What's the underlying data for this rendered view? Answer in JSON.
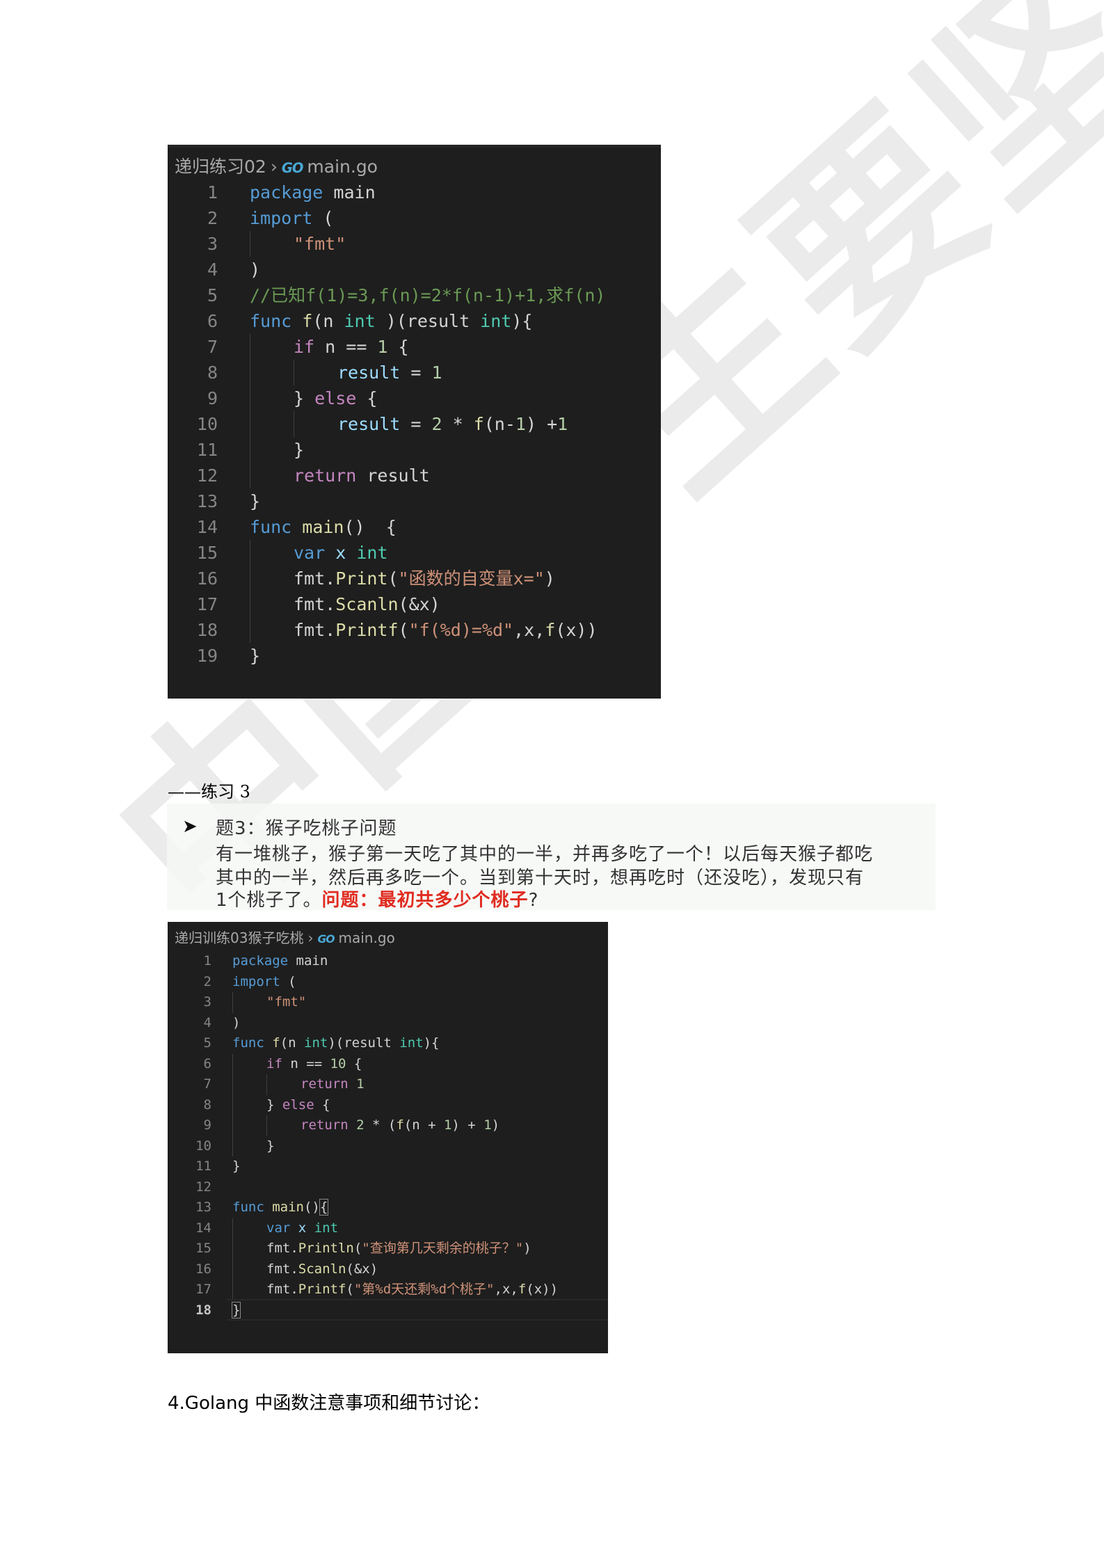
{
  "watermark": "中国学生要坚持",
  "block1": {
    "breadcrumb": {
      "folder": "递归练习02",
      "separator": "›",
      "icon": "go-icon",
      "icon_text": "GO",
      "file": "main.go"
    },
    "lines": [
      {
        "n": "1",
        "indent": 0,
        "tokens": [
          [
            "k-blue",
            "package"
          ],
          [
            "k-def",
            " main"
          ]
        ]
      },
      {
        "n": "2",
        "indent": 0,
        "tokens": [
          [
            "k-blue",
            "import"
          ],
          [
            "k-def",
            " ("
          ]
        ]
      },
      {
        "n": "3",
        "indent": 1,
        "tokens": [
          [
            "k-str",
            "\"fmt\""
          ]
        ]
      },
      {
        "n": "4",
        "indent": 0,
        "tokens": [
          [
            "k-def",
            ")"
          ]
        ]
      },
      {
        "n": "5",
        "indent": 0,
        "tokens": [
          [
            "k-cmt",
            "//已知f(1)=3,f(n)=2*f(n-1)+1,求f(n)"
          ]
        ]
      },
      {
        "n": "6",
        "indent": 0,
        "tokens": [
          [
            "k-blue",
            "func"
          ],
          [
            "k-def",
            " "
          ],
          [
            "k-yellow",
            "f"
          ],
          [
            "k-def",
            "(n "
          ],
          [
            "k-teal",
            "int"
          ],
          [
            "k-def",
            " )(result "
          ],
          [
            "k-teal",
            "int"
          ],
          [
            "k-def",
            "){"
          ]
        ]
      },
      {
        "n": "7",
        "indent": 1,
        "tokens": [
          [
            "k-purple",
            "if"
          ],
          [
            "k-def",
            " n == "
          ],
          [
            "k-num",
            "1"
          ],
          [
            "k-def",
            " {"
          ]
        ]
      },
      {
        "n": "8",
        "indent": 2,
        "tokens": [
          [
            "k-var",
            "result"
          ],
          [
            "k-def",
            " = "
          ],
          [
            "k-num",
            "1"
          ]
        ]
      },
      {
        "n": "9",
        "indent": 1,
        "tokens": [
          [
            "k-def",
            "} "
          ],
          [
            "k-purple",
            "else"
          ],
          [
            "k-def",
            " {"
          ]
        ]
      },
      {
        "n": "10",
        "indent": 2,
        "tokens": [
          [
            "k-var",
            "result"
          ],
          [
            "k-def",
            " = "
          ],
          [
            "k-num",
            "2"
          ],
          [
            "k-def",
            " * "
          ],
          [
            "k-yellow",
            "f"
          ],
          [
            "k-def",
            "(n-"
          ],
          [
            "k-num",
            "1"
          ],
          [
            "k-def",
            ") +"
          ],
          [
            "k-num",
            "1"
          ]
        ]
      },
      {
        "n": "11",
        "indent": 1,
        "tokens": [
          [
            "k-def",
            "}"
          ]
        ]
      },
      {
        "n": "12",
        "indent": 1,
        "tokens": [
          [
            "k-purple",
            "return"
          ],
          [
            "k-def",
            " result"
          ]
        ]
      },
      {
        "n": "13",
        "indent": 0,
        "tokens": [
          [
            "k-def",
            "}"
          ]
        ]
      },
      {
        "n": "14",
        "indent": 0,
        "tokens": [
          [
            "k-blue",
            "func"
          ],
          [
            "k-def",
            " "
          ],
          [
            "k-yellow",
            "main"
          ],
          [
            "k-def",
            "()  {"
          ]
        ]
      },
      {
        "n": "15",
        "indent": 1,
        "tokens": [
          [
            "k-blue",
            "var"
          ],
          [
            "k-def",
            " "
          ],
          [
            "k-var",
            "x"
          ],
          [
            "k-def",
            " "
          ],
          [
            "k-teal",
            "int"
          ]
        ]
      },
      {
        "n": "16",
        "indent": 1,
        "tokens": [
          [
            "k-def",
            "fmt."
          ],
          [
            "k-yellow",
            "Print"
          ],
          [
            "k-def",
            "("
          ],
          [
            "k-str",
            "\"函数的自变量x=\""
          ],
          [
            "k-def",
            ")"
          ]
        ]
      },
      {
        "n": "17",
        "indent": 1,
        "tokens": [
          [
            "k-def",
            "fmt."
          ],
          [
            "k-yellow",
            "Scanln"
          ],
          [
            "k-def",
            "(&x)"
          ]
        ]
      },
      {
        "n": "18",
        "indent": 1,
        "tokens": [
          [
            "k-def",
            "fmt."
          ],
          [
            "k-yellow",
            "Printf"
          ],
          [
            "k-def",
            "("
          ],
          [
            "k-str",
            "\"f(%d)=%d\""
          ],
          [
            "k-def",
            ",x,"
          ],
          [
            "k-yellow",
            "f"
          ],
          [
            "k-def",
            "(x))"
          ]
        ]
      },
      {
        "n": "19",
        "indent": 0,
        "tokens": [
          [
            "k-def",
            "}"
          ]
        ]
      }
    ]
  },
  "section_label": "——练习 3",
  "problem": {
    "bullet": "➤",
    "title": "题3：猴子吃桃子问题",
    "line1": "有一堆桃子，猴子第一天吃了其中的一半，并再多吃了一个！以后每天猴子都吃",
    "line2": "其中的一半，然后再多吃一个。当到第十天时，想再吃时（还没吃），发现只有",
    "line3_prefix": "1个桃子了。",
    "line3_highlight": "问题：最初共多少个桃子",
    "line3_suffix": "?"
  },
  "block2": {
    "breadcrumb": {
      "folder": "递归训练03猴子吃桃",
      "separator": "›",
      "icon": "go-icon",
      "icon_text": "GO",
      "file": "main.go"
    },
    "active_line": "18",
    "lines": [
      {
        "n": "1",
        "indent": 0,
        "tokens": [
          [
            "k-blue",
            "package"
          ],
          [
            "k-def",
            " main"
          ]
        ]
      },
      {
        "n": "2",
        "indent": 0,
        "tokens": [
          [
            "k-blue",
            "import"
          ],
          [
            "k-def",
            " ("
          ]
        ]
      },
      {
        "n": "3",
        "indent": 1,
        "tokens": [
          [
            "k-str",
            "\"fmt\""
          ]
        ]
      },
      {
        "n": "4",
        "indent": 0,
        "tokens": [
          [
            "k-def",
            ")"
          ]
        ]
      },
      {
        "n": "5",
        "indent": 0,
        "tokens": [
          [
            "k-blue",
            "func"
          ],
          [
            "k-def",
            " "
          ],
          [
            "k-yellow",
            "f"
          ],
          [
            "k-def",
            "(n "
          ],
          [
            "k-teal",
            "int"
          ],
          [
            "k-def",
            ")(result "
          ],
          [
            "k-teal",
            "int"
          ],
          [
            "k-def",
            "){"
          ]
        ]
      },
      {
        "n": "6",
        "indent": 1,
        "tokens": [
          [
            "k-purple",
            "if"
          ],
          [
            "k-def",
            " n == "
          ],
          [
            "k-num",
            "10"
          ],
          [
            "k-def",
            " {"
          ]
        ]
      },
      {
        "n": "7",
        "indent": 2,
        "tokens": [
          [
            "k-purple",
            "return"
          ],
          [
            "k-def",
            " "
          ],
          [
            "k-num",
            "1"
          ]
        ]
      },
      {
        "n": "8",
        "indent": 1,
        "tokens": [
          [
            "k-def",
            "} "
          ],
          [
            "k-purple",
            "else"
          ],
          [
            "k-def",
            " {"
          ]
        ]
      },
      {
        "n": "9",
        "indent": 2,
        "tokens": [
          [
            "k-purple",
            "return"
          ],
          [
            "k-def",
            " "
          ],
          [
            "k-num",
            "2"
          ],
          [
            "k-def",
            " * ("
          ],
          [
            "k-yellow",
            "f"
          ],
          [
            "k-def",
            "(n + "
          ],
          [
            "k-num",
            "1"
          ],
          [
            "k-def",
            ") + "
          ],
          [
            "k-num",
            "1"
          ],
          [
            "k-def",
            ")"
          ]
        ]
      },
      {
        "n": "10",
        "indent": 1,
        "tokens": [
          [
            "k-def",
            "}"
          ]
        ]
      },
      {
        "n": "11",
        "indent": 0,
        "tokens": [
          [
            "k-def",
            "}"
          ]
        ]
      },
      {
        "n": "12",
        "indent": 0,
        "tokens": []
      },
      {
        "n": "13",
        "indent": 0,
        "tokens": [
          [
            "k-blue",
            "func"
          ],
          [
            "k-def",
            " "
          ],
          [
            "k-yellow",
            "main"
          ],
          [
            "k-def",
            "()"
          ],
          [
            "k-def bm",
            "{"
          ]
        ]
      },
      {
        "n": "14",
        "indent": 1,
        "tokens": [
          [
            "k-blue",
            "var"
          ],
          [
            "k-def",
            " "
          ],
          [
            "k-var",
            "x"
          ],
          [
            "k-def",
            " "
          ],
          [
            "k-teal",
            "int"
          ]
        ]
      },
      {
        "n": "15",
        "indent": 1,
        "tokens": [
          [
            "k-def",
            "fmt."
          ],
          [
            "k-yellow",
            "Println"
          ],
          [
            "k-def",
            "("
          ],
          [
            "k-str",
            "\"查询第几天剩余的桃子？\""
          ],
          [
            "k-def",
            ")"
          ]
        ]
      },
      {
        "n": "16",
        "indent": 1,
        "tokens": [
          [
            "k-def",
            "fmt."
          ],
          [
            "k-yellow",
            "Scanln"
          ],
          [
            "k-def",
            "(&x)"
          ]
        ]
      },
      {
        "n": "17",
        "indent": 1,
        "tokens": [
          [
            "k-def",
            "fmt."
          ],
          [
            "k-yellow",
            "Printf"
          ],
          [
            "k-def",
            "("
          ],
          [
            "k-str",
            "\"第%d天还剩%d个桃子\""
          ],
          [
            "k-def",
            ",x,"
          ],
          [
            "k-yellow",
            "f"
          ],
          [
            "k-def",
            "(x))"
          ]
        ]
      },
      {
        "n": "18",
        "indent": 0,
        "tokens": [
          [
            "k-def bm",
            "}"
          ]
        ]
      }
    ]
  },
  "heading4": "4.Golang 中函数注意事项和细节讨论："
}
